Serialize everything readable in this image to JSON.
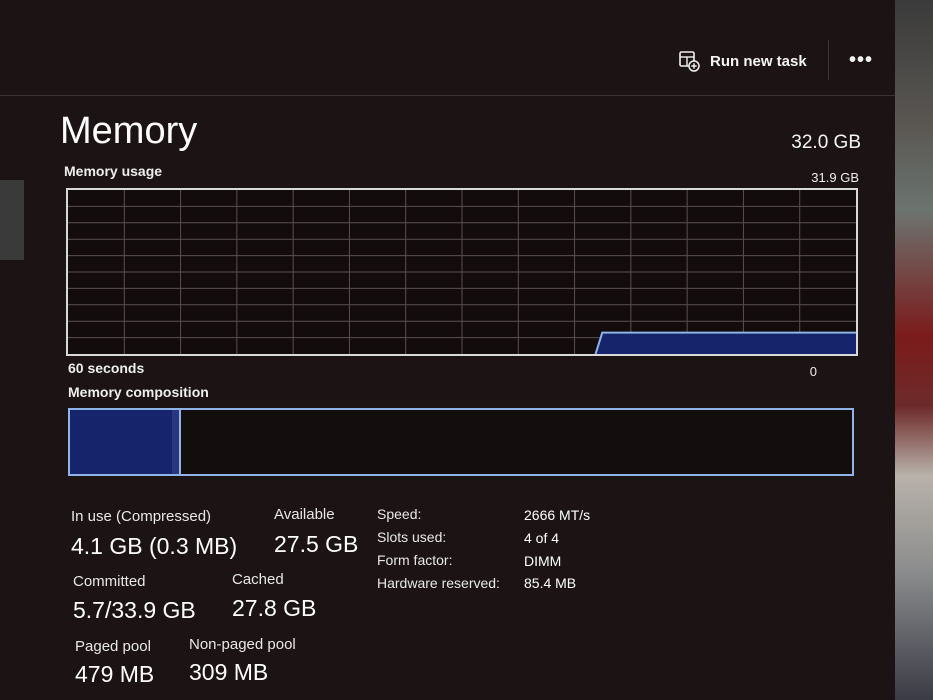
{
  "command_bar": {
    "run_new_task_label": "Run new task",
    "run_new_task_icon": "run-task-icon",
    "more_label": "•••"
  },
  "memory": {
    "title": "Memory",
    "total": "32.0 GB",
    "usage_graph": {
      "label": "Memory usage",
      "max_label": "31.9 GB",
      "time_span_label": "60 seconds",
      "min_label": "0",
      "accent_color": "#16256b",
      "line_color": "#8fb4e8",
      "grid_color": "#5a5050",
      "history_fraction_used": [
        0,
        0,
        0,
        0,
        0,
        0,
        0,
        0,
        0,
        0,
        0,
        0,
        0,
        0,
        0,
        0,
        0,
        0,
        0,
        0,
        0,
        0,
        0,
        0,
        0,
        0,
        0,
        0,
        0,
        0,
        0,
        0,
        0,
        0,
        0,
        0,
        0,
        0,
        0,
        0,
        0.13,
        0.13,
        0.13,
        0.13,
        0.13,
        0.13,
        0.13,
        0.13,
        0.13,
        0.13,
        0.13,
        0.13,
        0.13,
        0.13,
        0.13,
        0.13,
        0.13,
        0.13,
        0.13,
        0.13
      ]
    },
    "composition": {
      "label": "Memory composition",
      "in_use_fraction": 0.13,
      "modified_fraction": 0.01
    },
    "stats": {
      "in_use_label": "In use (Compressed)",
      "in_use_value": "4.1 GB (0.3 MB)",
      "available_label": "Available",
      "available_value": "27.5 GB",
      "committed_label": "Committed",
      "committed_value": "5.7/33.9 GB",
      "cached_label": "Cached",
      "cached_value": "27.8 GB",
      "paged_pool_label": "Paged pool",
      "paged_pool_value": "479 MB",
      "non_paged_pool_label": "Non-paged pool",
      "non_paged_pool_value": "309 MB"
    },
    "details": {
      "speed_label": "Speed:",
      "speed_value": "2666 MT/s",
      "slots_label": "Slots used:",
      "slots_value": "4 of 4",
      "form_factor_label": "Form factor:",
      "form_factor_value": "DIMM",
      "hw_reserved_label": "Hardware reserved:",
      "hw_reserved_value": "85.4 MB"
    }
  }
}
